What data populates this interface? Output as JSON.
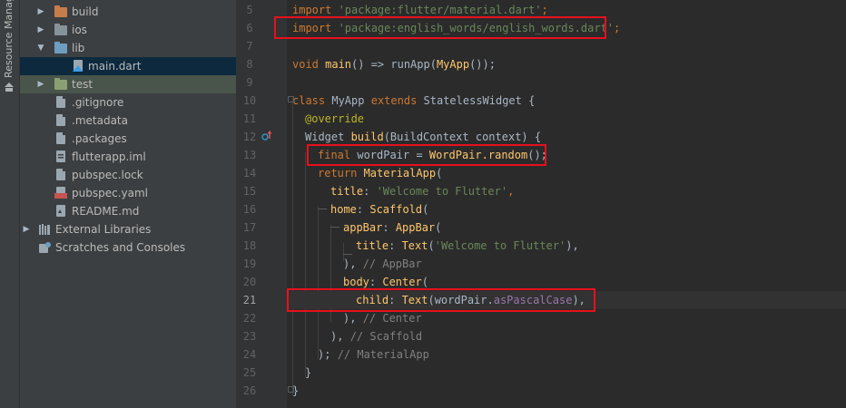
{
  "tool_strip": {
    "label": "Resource Manager",
    "icon": "resource-manager-icon"
  },
  "tree": {
    "items": [
      {
        "label": "build",
        "icon": "folder-orange-icon",
        "expanded": false
      },
      {
        "label": "ios",
        "icon": "folder-icon",
        "expanded": false
      },
      {
        "label": "lib",
        "icon": "folder-blue-icon",
        "expanded": true
      },
      {
        "label": "main.dart",
        "icon": "dart-file-icon",
        "selected": true
      },
      {
        "label": "test",
        "icon": "folder-green-icon",
        "expanded": false
      },
      {
        "label": ".gitignore",
        "icon": "file-icon"
      },
      {
        "label": ".metadata",
        "icon": "file-icon"
      },
      {
        "label": ".packages",
        "icon": "file-icon"
      },
      {
        "label": "flutterapp.iml",
        "icon": "iml-file-icon"
      },
      {
        "label": "pubspec.lock",
        "icon": "file-icon"
      },
      {
        "label": "pubspec.yaml",
        "icon": "yaml-file-icon"
      },
      {
        "label": "README.md",
        "icon": "markdown-file-icon"
      },
      {
        "label": "External Libraries",
        "icon": "libraries-icon",
        "expanded": false
      },
      {
        "label": "Scratches and Consoles",
        "icon": "scratches-icon"
      }
    ]
  },
  "editor": {
    "current_line": "21",
    "lines": [
      {
        "n": "5",
        "parts": [
          [
            "kw",
            "import "
          ],
          [
            "str",
            "'package:flutter/material.dart'"
          ],
          [
            "kw",
            ";"
          ]
        ]
      },
      {
        "n": "6",
        "parts": [
          [
            "kw",
            "import "
          ],
          [
            "str",
            "'package:english_words/english_words.dart'"
          ],
          [
            "kw",
            ";"
          ]
        ]
      },
      {
        "n": "7",
        "parts": []
      },
      {
        "n": "8",
        "parts": [
          [
            "kw",
            "void "
          ],
          [
            "fn",
            "main"
          ],
          [
            "",
            "() => runApp("
          ],
          [
            "fn",
            "MyApp"
          ],
          [
            "",
            "());"
          ]
        ]
      },
      {
        "n": "9",
        "parts": []
      },
      {
        "n": "10",
        "parts": [
          [
            "kw",
            "class "
          ],
          [
            "",
            "MyApp "
          ],
          [
            "kw",
            "extends "
          ],
          [
            "",
            "StatelessWidget {"
          ]
        ]
      },
      {
        "n": "11",
        "parts": [
          [
            "ann",
            "@override"
          ]
        ]
      },
      {
        "n": "12",
        "parts": [
          [
            "",
            "Widget "
          ],
          [
            "fn",
            "build"
          ],
          [
            "",
            "(BuildContext context) {"
          ]
        ]
      },
      {
        "n": "13",
        "parts": [
          [
            "kw",
            "final "
          ],
          [
            "",
            "wordPair = "
          ],
          [
            "fn",
            "WordPair.random"
          ],
          [
            "",
            "();"
          ]
        ]
      },
      {
        "n": "14",
        "parts": [
          [
            "kw",
            "return "
          ],
          [
            "fn",
            "MaterialApp"
          ],
          [
            "",
            "("
          ]
        ]
      },
      {
        "n": "15",
        "parts": [
          [
            "param",
            "title"
          ],
          [
            "",
            ": "
          ],
          [
            "str",
            "'Welcome to Flutter'"
          ],
          [
            "kw",
            ","
          ]
        ]
      },
      {
        "n": "16",
        "parts": [
          [
            "param",
            "home"
          ],
          [
            "",
            ": "
          ],
          [
            "fn",
            "Scaffold"
          ],
          [
            "",
            "("
          ]
        ]
      },
      {
        "n": "17",
        "parts": [
          [
            "param",
            "appBar"
          ],
          [
            "",
            ": "
          ],
          [
            "fn",
            "AppBar"
          ],
          [
            "",
            "("
          ]
        ]
      },
      {
        "n": "18",
        "parts": [
          [
            "param",
            "title"
          ],
          [
            "",
            ": "
          ],
          [
            "fn",
            "Text"
          ],
          [
            "",
            "("
          ],
          [
            "str",
            "'Welcome to Flutter'"
          ],
          [
            "",
            "),"
          ]
        ]
      },
      {
        "n": "19",
        "parts": [
          [
            "",
            "), "
          ],
          [
            "cmt",
            "// AppBar"
          ]
        ]
      },
      {
        "n": "20",
        "parts": [
          [
            "param",
            "body"
          ],
          [
            "",
            ": "
          ],
          [
            "fn",
            "Center"
          ],
          [
            "",
            "("
          ]
        ]
      },
      {
        "n": "21",
        "parts": [
          [
            "param",
            "child"
          ],
          [
            "",
            ": "
          ],
          [
            "fn",
            "Text"
          ],
          [
            "",
            "(wordPair."
          ],
          [
            "fld",
            "asPascalCase"
          ],
          [
            "",
            "),"
          ]
        ]
      },
      {
        "n": "22",
        "parts": [
          [
            "",
            "), "
          ],
          [
            "cmt",
            "// Center"
          ]
        ]
      },
      {
        "n": "23",
        "parts": [
          [
            "",
            "), "
          ],
          [
            "cmt",
            "// Scaffold"
          ]
        ]
      },
      {
        "n": "24",
        "parts": [
          [
            "",
            "); "
          ],
          [
            "cmt",
            "// MaterialApp"
          ]
        ]
      },
      {
        "n": "25",
        "parts": [
          [
            "",
            "}"
          ]
        ]
      },
      {
        "n": "26",
        "parts": [
          [
            "",
            "}"
          ]
        ]
      }
    ]
  },
  "colors": {
    "highlight_box": "#e8101d"
  }
}
